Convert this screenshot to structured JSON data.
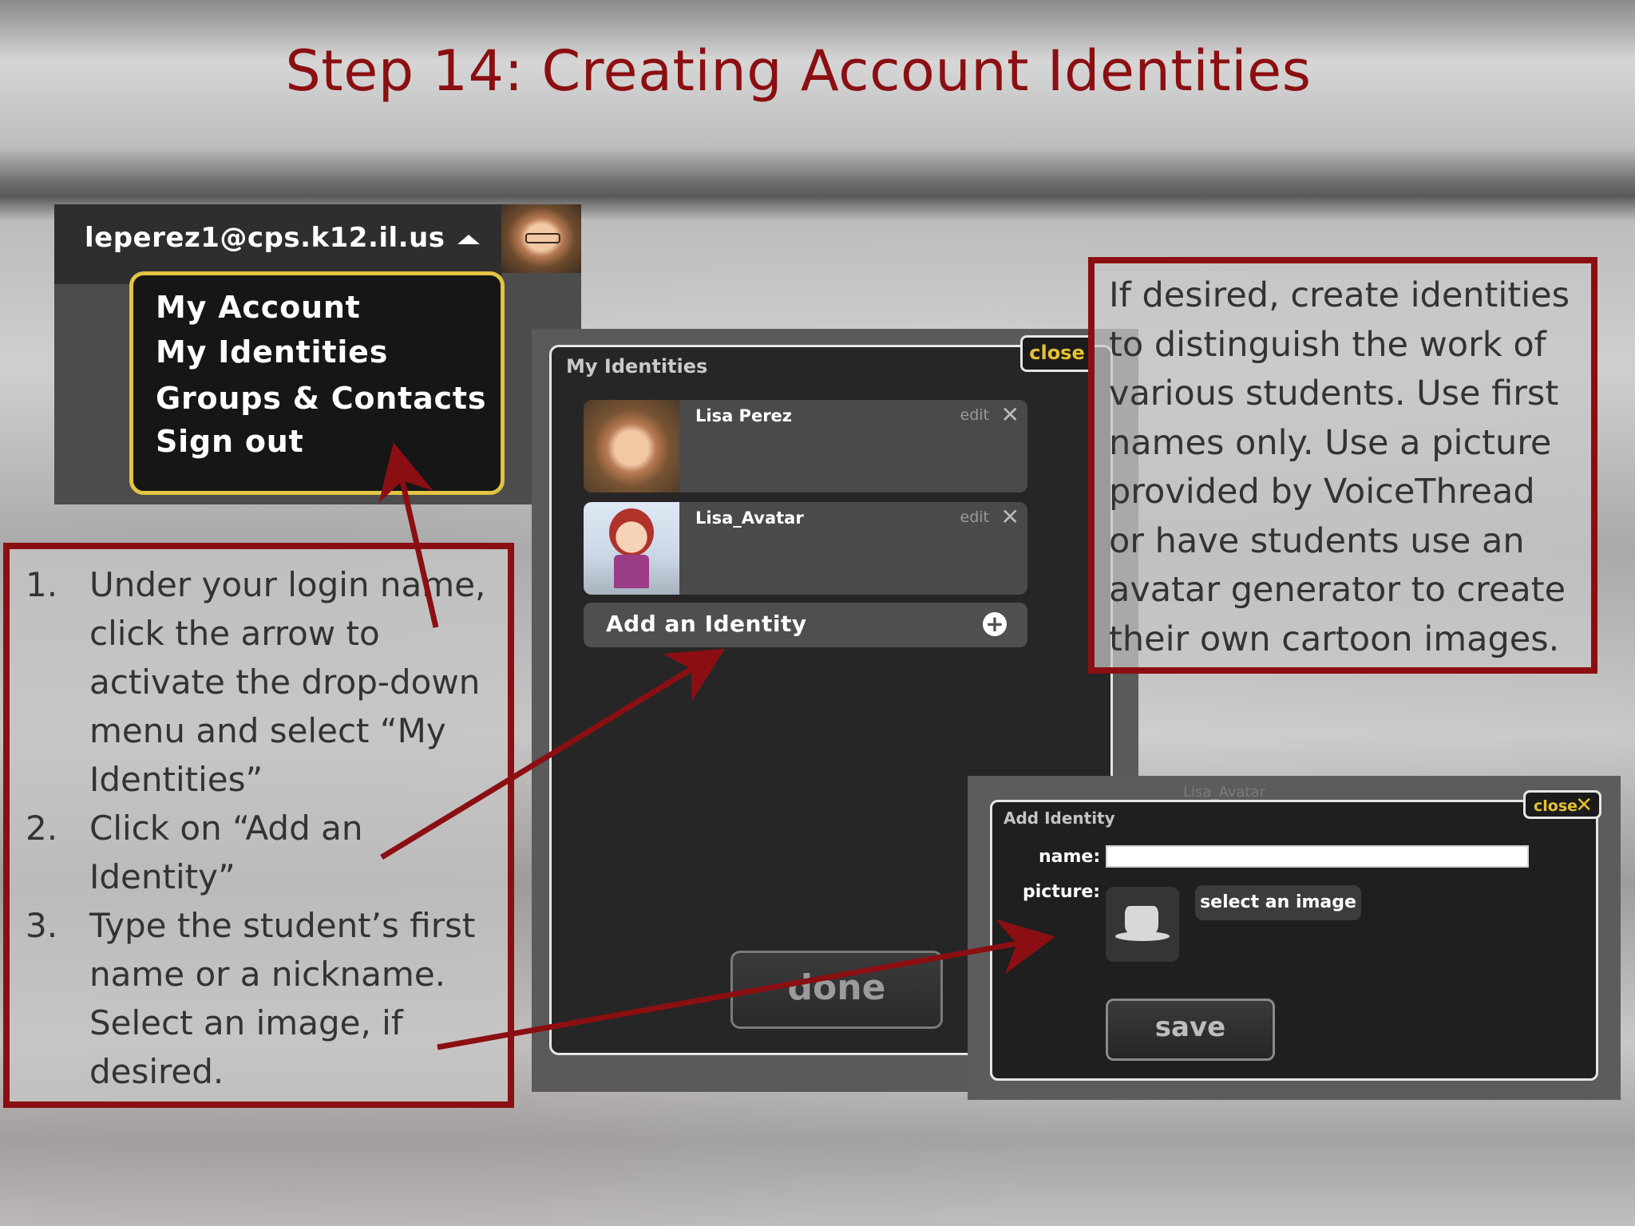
{
  "slide": {
    "title": "Step 14: Creating Account Identities"
  },
  "account_menu": {
    "email": "leperez1@cps.k12.il.us",
    "items": [
      "My Account",
      "My Identities",
      "Groups & Contacts",
      "Sign out"
    ]
  },
  "my_identities": {
    "title": "My Identities",
    "close_label": "close",
    "identities": [
      {
        "name": "Lisa Perez",
        "edit_label": "edit",
        "remove_icon": "close-icon"
      },
      {
        "name": "Lisa_Avatar",
        "edit_label": "edit",
        "remove_icon": "close-icon"
      }
    ],
    "add_label": "Add an Identity",
    "add_icon": "plus-circle-icon",
    "done_label": "done"
  },
  "add_identity": {
    "ghost_text": "Lisa_Avatar",
    "title": "Add Identity",
    "close_label": "close",
    "name_label": "name:",
    "name_value": "",
    "picture_label": "picture:",
    "picture_icon": "hat-icon",
    "select_image_label": "select an image",
    "save_label": "save"
  },
  "instructions": {
    "steps": [
      {
        "num": "1.",
        "text": "Under your login name, click the arrow to activate the drop-down menu and select “My Identities”"
      },
      {
        "num": "2.",
        "text": "Click on “Add an Identity”"
      },
      {
        "num": "3.",
        "text": "Type the student’s first name or a nickname. Select an image, if desired."
      }
    ]
  },
  "info_box": {
    "text": "If desired, create identities to distinguish the work of various students. Use first names only.  Use a picture provided by VoiceThread or have students use an avatar generator to create their own cartoon images."
  },
  "colors": {
    "title": "#8b0f12",
    "callout_border": "#8b0f12",
    "menu_border": "#e2c443",
    "close_text": "#e7c22d"
  }
}
